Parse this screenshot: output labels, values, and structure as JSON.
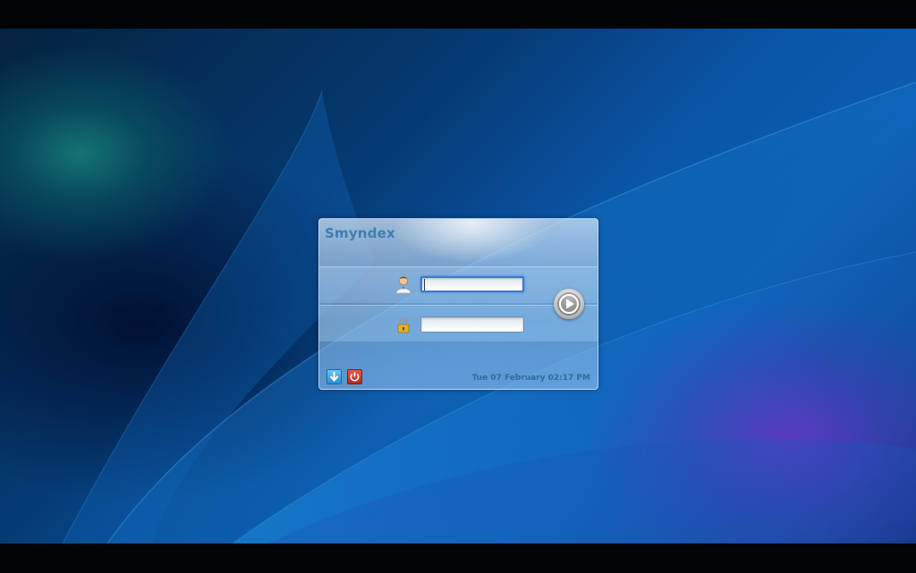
{
  "login_panel": {
    "title": "Smyndex",
    "username": {
      "icon": "user-icon",
      "value": "",
      "placeholder": ""
    },
    "password": {
      "icon": "lock-icon",
      "value": "",
      "placeholder": ""
    },
    "login_button_icon": "play-arrow-icon",
    "session_button_icon": "session-arrow-down-icon",
    "shutdown_button_icon": "power-icon",
    "datetime": "Tue 07 February 02:17 PM"
  },
  "colors": {
    "title": "#3a7fb0",
    "clock": "#2f6d96",
    "session_button": "#2a8fd6",
    "shutdown_button": "#b52a22",
    "focus_ring": "#3f79c8"
  }
}
